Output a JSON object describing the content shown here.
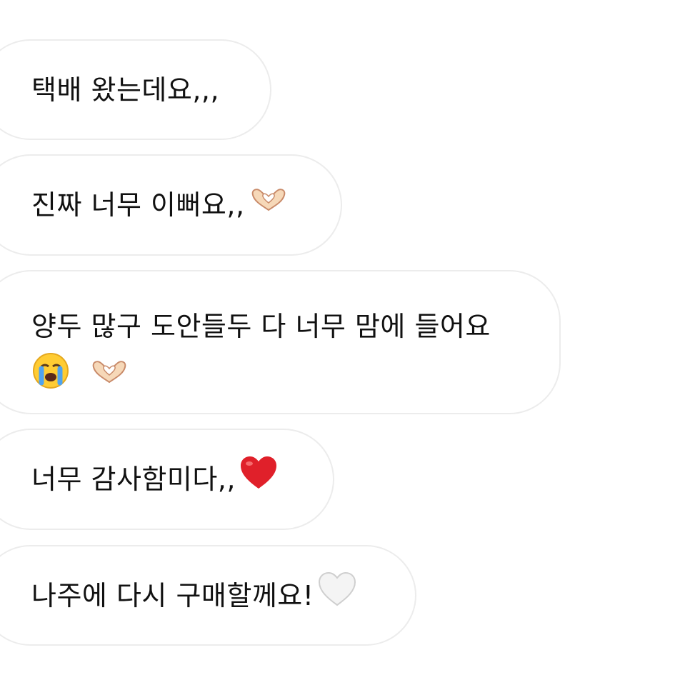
{
  "messages": [
    {
      "text": "택배 왔는데요,,,"
    },
    {
      "text": "진짜 너무 이뻐요,,",
      "emoji": "heart-hands"
    },
    {
      "text": "양두 많구 도안들두 다 너무 맘에 들어요",
      "emoji": [
        "crying-face",
        "heart-hands"
      ]
    },
    {
      "text": "너무 감사함미다,,",
      "emoji": "red-heart"
    },
    {
      "text": "나주에 다시 구매할께요!",
      "emoji": "white-heart"
    }
  ],
  "colors": {
    "bubble_border": "#ececec",
    "text": "#111111",
    "red_heart": "#e0202a"
  }
}
